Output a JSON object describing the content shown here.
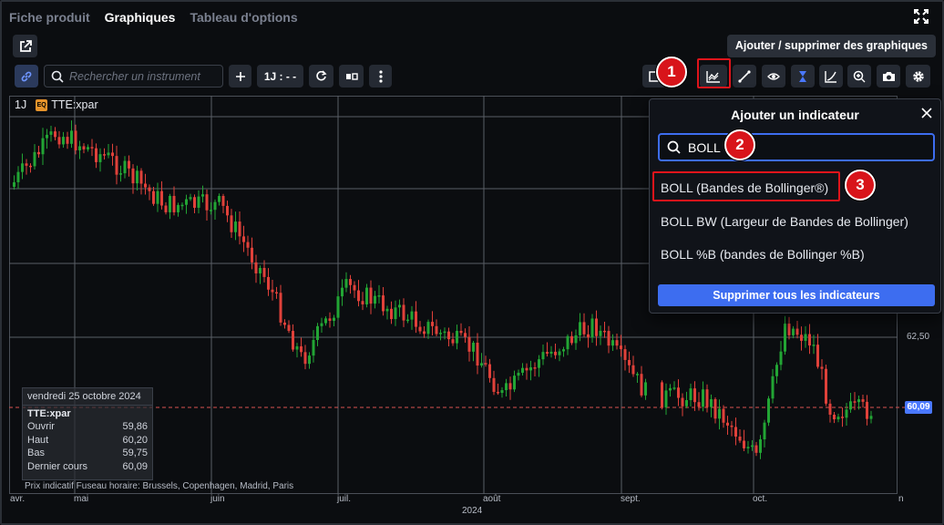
{
  "tabs": [
    {
      "label": "Fiche produit",
      "active": false
    },
    {
      "label": "Graphiques",
      "active": true
    },
    {
      "label": "Tableau d'options",
      "active": false
    }
  ],
  "toolbar": {
    "add_graph_label": "Ajouter / supprimer des graphiques",
    "search_placeholder": "Rechercher un instrument",
    "interval_label": "1J : - -"
  },
  "chart": {
    "interval": "1J",
    "symbol_badge": "EQ",
    "symbol": "TTE:xpar",
    "current_price": "60,09",
    "price_label": "62,50",
    "timezone_text": "Prix indicatif  Fuseau horaire: Brussels, Copenhagen, Madrid, Paris",
    "year_label": "2024",
    "month_labels": [
      "avr.",
      "mai",
      "juin",
      "juil.",
      "août",
      "sept.",
      "oct.",
      "n"
    ],
    "colors": {
      "up": "#22a534",
      "down": "#e0413a",
      "grid": "#5a5f66",
      "price_line": "#d9534f",
      "accent": "#3d6df0"
    }
  },
  "infobox": {
    "date": "vendredi 25 octobre 2024",
    "symbol": "TTE:xpar",
    "rows": [
      {
        "label": "Ouvrir",
        "value": "59,86"
      },
      {
        "label": "Haut",
        "value": "60,20"
      },
      {
        "label": "Bas",
        "value": "59,75"
      },
      {
        "label": "Dernier cours",
        "value": "60,09"
      }
    ]
  },
  "indicator_panel": {
    "title": "Ajouter un indicateur",
    "search_value": "BOLL",
    "results": [
      "BOLL (Bandes de Bollinger®)",
      "BOLL BW (Largeur de Bandes de Bollinger)",
      "BOLL %B (bandes de Bollinger %B)"
    ],
    "delete_all_label": "Supprimer tous les indicateurs"
  },
  "steps": [
    "1",
    "2",
    "3"
  ]
}
